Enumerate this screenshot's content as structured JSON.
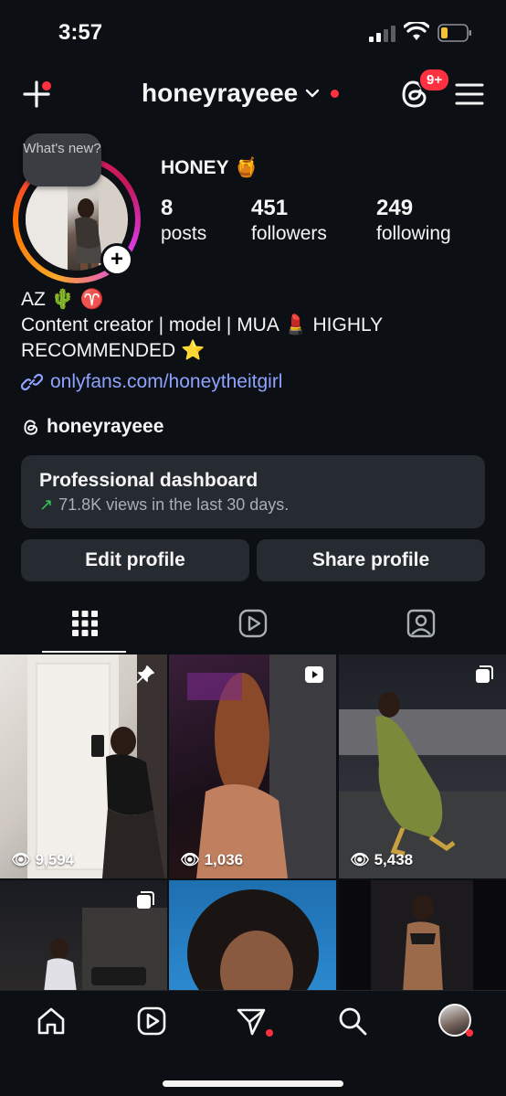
{
  "status_bar": {
    "time": "3:57"
  },
  "header": {
    "username": "honeyrayeee",
    "notification_badge": "9+"
  },
  "profile": {
    "story_bubble": "What's new?",
    "display_name": "HONEY",
    "display_emoji": "🍯",
    "stats": [
      {
        "value": "8",
        "label": "posts"
      },
      {
        "value": "451",
        "label": "followers"
      },
      {
        "value": "249",
        "label": "following"
      }
    ],
    "bio_line1": "AZ 🌵 ♈",
    "bio_line2": "Content creator | model | MUA 💄 HIGHLY",
    "bio_line3": "RECOMMENDED ⭐",
    "link": "onlyfans.com/honeytheitgirl",
    "threads_handle": "honeyrayeee"
  },
  "dashboard": {
    "title": "Professional dashboard",
    "subtitle": "71.8K views in the last 30 days."
  },
  "buttons": {
    "edit": "Edit profile",
    "share": "Share profile"
  },
  "grid": [
    {
      "views": "9,594",
      "badge": "pin-icon"
    },
    {
      "views": "1,036",
      "badge": "reel-icon"
    },
    {
      "views": "5,438",
      "badge": "carousel-icon"
    },
    {
      "views": "",
      "badge": "carousel-icon"
    },
    {
      "views": "",
      "badge": ""
    },
    {
      "views": "",
      "badge": ""
    }
  ],
  "colors": {
    "accent_red": "#ff3040",
    "link": "#8ea3ff",
    "trend_green": "#34c759",
    "background": "#0c0f14",
    "card": "#262a31"
  }
}
